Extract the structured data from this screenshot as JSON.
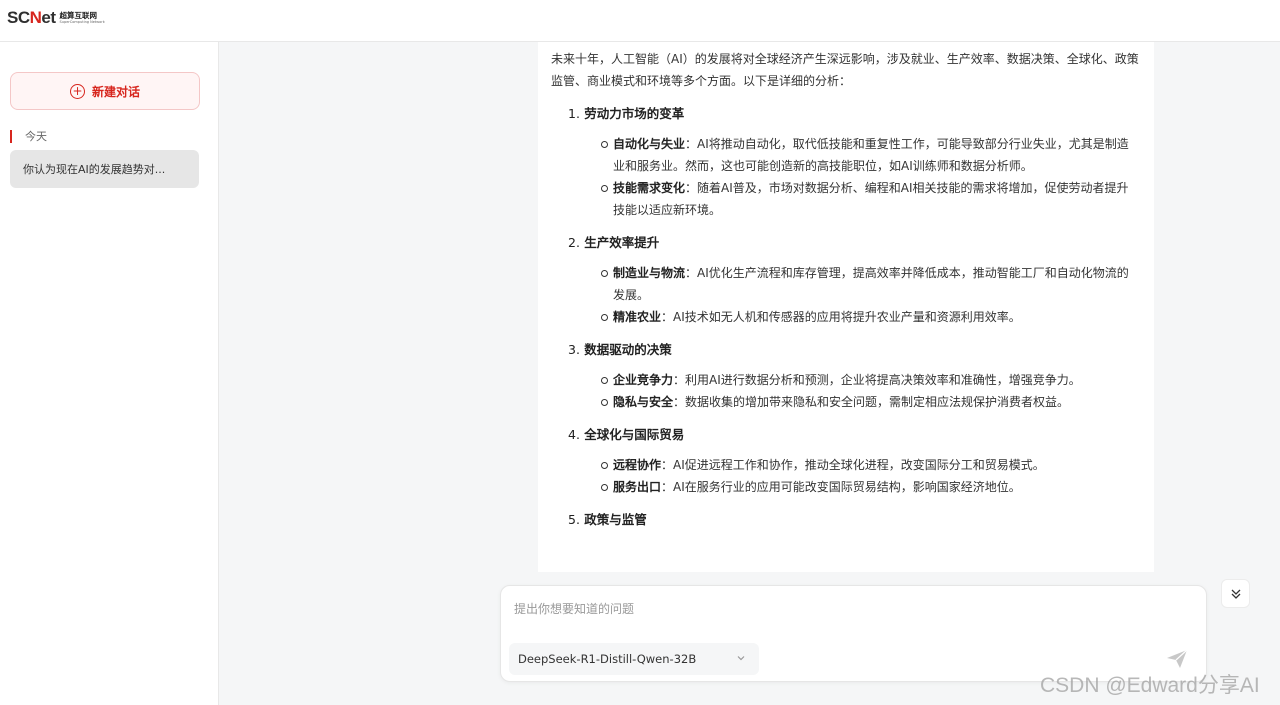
{
  "header": {
    "logo_text_dark": "SC",
    "logo_text_red": "N",
    "logo_text_tail": "et",
    "logo_sub_cn": "超算互联网",
    "logo_sub_en": "SuperComputing Network"
  },
  "sidebar": {
    "new_chat_label": "新建对话",
    "group_label": "今天",
    "history": [
      {
        "title": "你认为现在AI的发展趋势对..."
      }
    ]
  },
  "chat": {
    "intro": "未来十年，人工智能（AI）的发展将对全球经济产生深远影响，涉及就业、生产效率、数据决策、全球化、政策监管、商业模式和环境等多个方面。以下是详细的分析：",
    "sections": [
      {
        "num": "1.",
        "title": "劳动力市场的变革",
        "points": [
          {
            "term": "自动化与失业",
            "text": "：AI将推动自动化，取代低技能和重复性工作，可能导致部分行业失业，尤其是制造业和服务业。然而，这也可能创造新的高技能职位，如AI训练师和数据分析师。"
          },
          {
            "term": "技能需求变化",
            "text": "：随着AI普及，市场对数据分析、编程和AI相关技能的需求将增加，促使劳动者提升技能以适应新环境。"
          }
        ]
      },
      {
        "num": "2.",
        "title": "生产效率提升",
        "points": [
          {
            "term": "制造业与物流",
            "text": "：AI优化生产流程和库存管理，提高效率并降低成本，推动智能工厂和自动化物流的发展。"
          },
          {
            "term": "精准农业",
            "text": "：AI技术如无人机和传感器的应用将提升农业产量和资源利用效率。"
          }
        ]
      },
      {
        "num": "3.",
        "title": "数据驱动的决策",
        "points": [
          {
            "term": "企业竞争力",
            "text": "：利用AI进行数据分析和预测，企业将提高决策效率和准确性，增强竞争力。"
          },
          {
            "term": "隐私与安全",
            "text": "：数据收集的增加带来隐私和安全问题，需制定相应法规保护消费者权益。"
          }
        ]
      },
      {
        "num": "4.",
        "title": "全球化与国际贸易",
        "points": [
          {
            "term": "远程协作",
            "text": "：AI促进远程工作和协作，推动全球化进程，改变国际分工和贸易模式。"
          },
          {
            "term": "服务出口",
            "text": "：AI在服务行业的应用可能改变国际贸易结构，影响国家经济地位。"
          }
        ]
      },
      {
        "num": "5.",
        "title": "政策与监管",
        "points": []
      }
    ]
  },
  "composer": {
    "placeholder": "提出你想要知道的问题",
    "model": "DeepSeek-R1-Distill-Qwen-32B"
  },
  "watermark": "CSDN @Edward分享AI",
  "colors": {
    "accent": "#d7261e",
    "sidebar_active": "#e6e6e6",
    "page_bg": "#f5f6f7"
  },
  "icons": {
    "new_chat": "plus-circle-icon",
    "model_dropdown": "chevron-down-icon",
    "send": "send-icon",
    "scroll_down": "double-chevron-down-icon"
  }
}
